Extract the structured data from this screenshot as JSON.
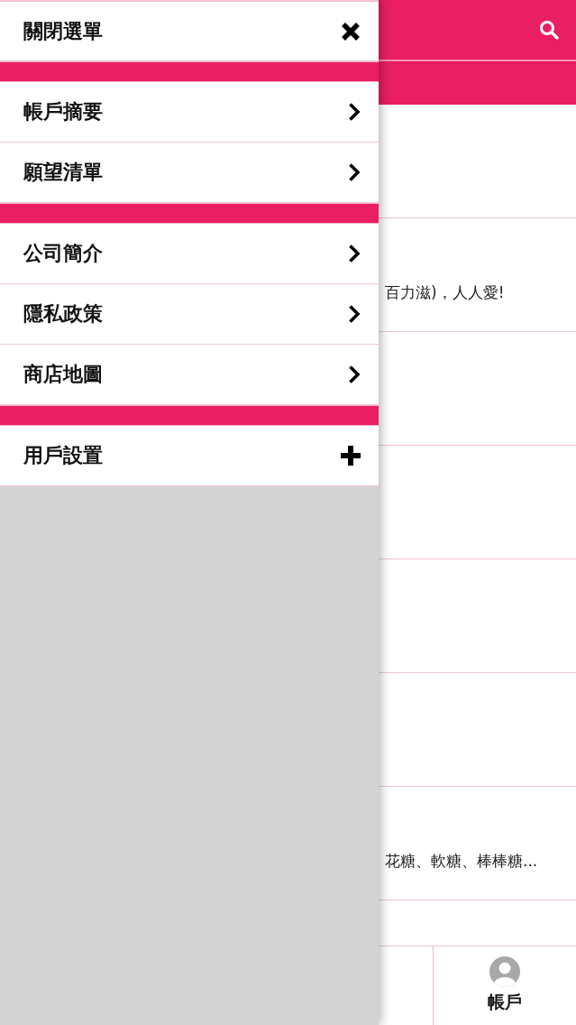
{
  "drawer": {
    "groups": [
      {
        "items": [
          {
            "label": "關閉選單",
            "kind": "close"
          }
        ]
      },
      {
        "items": [
          {
            "label": "帳戶摘要",
            "kind": "link"
          },
          {
            "label": "願望清單",
            "kind": "link"
          }
        ]
      },
      {
        "items": [
          {
            "label": "公司簡介",
            "kind": "link"
          },
          {
            "label": "隱私政策",
            "kind": "link"
          },
          {
            "label": "商店地圖",
            "kind": "link"
          }
        ]
      },
      {
        "items": [
          {
            "label": "用戶設置",
            "kind": "expand",
            "expanded": false
          }
        ]
      }
    ]
  },
  "content": {
    "rows": [
      {},
      {
        "description": "百力滋)，人人愛!"
      },
      {},
      {},
      {},
      {},
      {
        "description": "花糖、軟糖、棒棒糖..."
      },
      {}
    ]
  },
  "tab_bar": {
    "tabs": [
      {
        "label": "帳戶"
      }
    ]
  }
}
